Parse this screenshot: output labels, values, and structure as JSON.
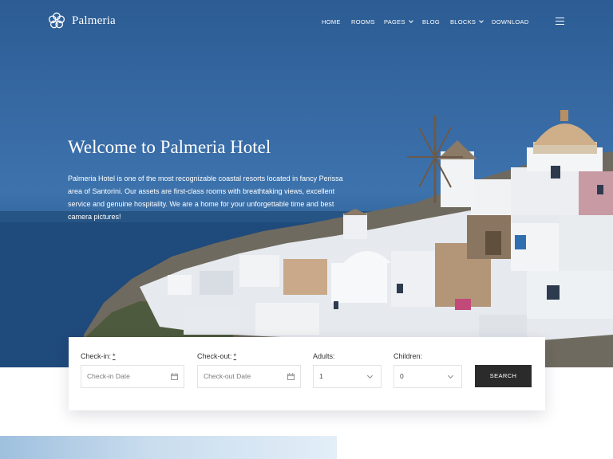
{
  "header": {
    "logo_text": "Palmeria",
    "nav": [
      {
        "label": "HOME",
        "dropdown": false
      },
      {
        "label": "ROOMS",
        "dropdown": false
      },
      {
        "label": "PAGES",
        "dropdown": true
      },
      {
        "label": "BLOG",
        "dropdown": false
      },
      {
        "label": "BLOCKS",
        "dropdown": true
      },
      {
        "label": "DOWNLOAD",
        "dropdown": false
      }
    ]
  },
  "hero": {
    "title": "Welcome to Palmeria Hotel",
    "description": "Palmeria Hotel is one of the most recognizable coastal resorts located in fancy Perissa area of Santorini. Our assets are first-class rooms with breathtaking views, excellent service and genuine hospitality. We are a home for your unforgettable time and best camera pictures!"
  },
  "booking": {
    "checkin_label": "Check-in:",
    "checkin_required": "*",
    "checkin_placeholder": "Check-in Date",
    "checkout_label": "Check-out:",
    "checkout_required": "*",
    "checkout_placeholder": "Check-out Date",
    "adults_label": "Adults:",
    "adults_value": "1",
    "children_label": "Children:",
    "children_value": "0",
    "search_label": "SEARCH"
  },
  "icons": {
    "logo": "flower-logo-icon",
    "menu": "hamburger-menu-icon",
    "calendar": "calendar-icon",
    "dropdown": "chevron-down-icon"
  },
  "colors": {
    "hero_blue": "#3769a3",
    "button_dark": "#2b2b2b",
    "text_dark": "#333333"
  }
}
